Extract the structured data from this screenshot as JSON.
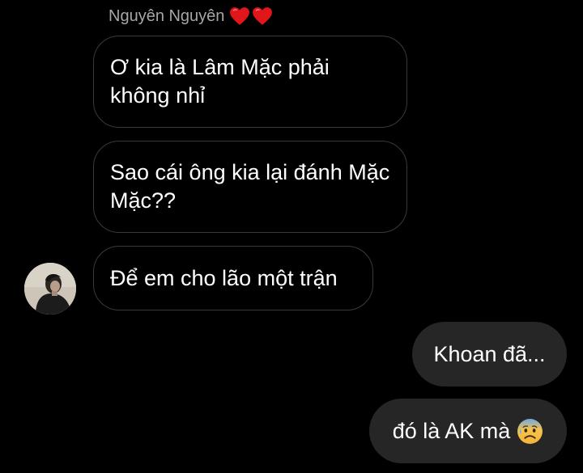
{
  "conversation": {
    "sender_name": "Nguyên Nguyên",
    "sender_name_decoration": [
      "heart-icon",
      "heart-icon"
    ],
    "accent_colors": {
      "background": "#000000",
      "incoming_border": "#3a3a3a",
      "outgoing_bubble": "#262626",
      "sender_name": "#a7a7a7",
      "heart": "#e0161b"
    },
    "messages": [
      {
        "direction": "incoming",
        "text": "Ơ kia là Lâm Mặc phải không nhỉ"
      },
      {
        "direction": "incoming",
        "text": "Sao cái ông kia lại đánh Mặc Mặc??"
      },
      {
        "direction": "incoming",
        "text": "Để em cho lão một trận"
      },
      {
        "direction": "outgoing",
        "text": "Khoan đã..."
      },
      {
        "direction": "outgoing",
        "text": "đó là AK mà",
        "trailing_icon": "anxious-face-with-sweat-emoji-icon"
      }
    ]
  }
}
